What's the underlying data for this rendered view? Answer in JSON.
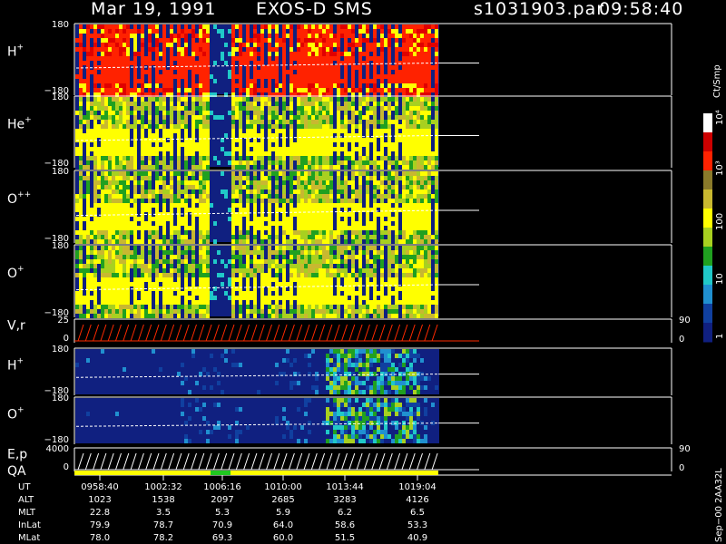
{
  "header": {
    "date": "Mar 19, 1991",
    "mission": "EXOS-D SMS",
    "file": "s1031903.par",
    "time": "09:58:40"
  },
  "colorbar": {
    "unit": "Ct/Smp",
    "ticks": [
      "10⁴",
      "10³",
      "100",
      "10",
      "1"
    ],
    "colors": [
      "#ffffff",
      "#cc0000",
      "#ff2200",
      "#8a7a2a",
      "#c8b830",
      "#ffff00",
      "#a8d020",
      "#20a020",
      "#20c8c8",
      "#2090d0",
      "#1040a0",
      "#102080"
    ]
  },
  "panels": [
    {
      "id": "hplus-top",
      "label": "H",
      "sup": "+",
      "ymax": "180",
      "ymin": "−180",
      "style": "spectro-red"
    },
    {
      "id": "heplus",
      "label": "He",
      "sup": "+",
      "ymax": "180",
      "ymin": "−180",
      "style": "spectro-yellow"
    },
    {
      "id": "oplusplus",
      "label": "O",
      "sup": "++",
      "ymax": "180",
      "ymin": "−180",
      "style": "spectro-yellow"
    },
    {
      "id": "oplus-top",
      "label": "O",
      "sup": "+",
      "ymax": "180",
      "ymin": "−180",
      "style": "spectro-yellow"
    },
    {
      "id": "vr",
      "label": "V,r",
      "sup": "",
      "ymax": "25",
      "ymin": "0",
      "right_top": "90",
      "right_bot": "0",
      "style": "line"
    },
    {
      "id": "hplus-low",
      "label": "H",
      "sup": "+",
      "ymax": "180",
      "ymin": "−180",
      "style": "spectro-blue"
    },
    {
      "id": "oplus-low",
      "label": "O",
      "sup": "+",
      "ymax": "180",
      "ymin": "−180",
      "style": "spectro-blue"
    },
    {
      "id": "ep",
      "label": "E,p",
      "sup": "",
      "ymax": "4000",
      "ymin": "0",
      "right_top": "90",
      "right_bot": "0",
      "style": "line"
    }
  ],
  "qa_label": "QA",
  "footer": {
    "rows": [
      {
        "name": "UT",
        "values": [
          "0958:40",
          "1002:32",
          "1006:16",
          "1010:00",
          "1013:44",
          "1019:04"
        ]
      },
      {
        "name": "ALT",
        "values": [
          "1023",
          "1538",
          "2097",
          "2685",
          "3283",
          "4126"
        ]
      },
      {
        "name": "MLT",
        "values": [
          "22.8",
          "3.5",
          "5.3",
          "5.9",
          "6.2",
          "6.5"
        ]
      },
      {
        "name": "InLat",
        "values": [
          "79.9",
          "78.7",
          "70.9",
          "64.0",
          "58.6",
          "53.3"
        ]
      },
      {
        "name": "MLat",
        "values": [
          "78.0",
          "78.2",
          "69.3",
          "60.0",
          "51.5",
          "40.9"
        ]
      }
    ]
  },
  "side_label": "Sep−00  2AA32L",
  "chart_data": {
    "type": "heatmap",
    "title": "Mar 19, 1991   EXOS-D SMS",
    "x": [
      "0958:40",
      "1002:32",
      "1006:16",
      "1010:00",
      "1013:44",
      "1019:04"
    ],
    "panels": [
      {
        "name": "H+",
        "ylim": [
          -180,
          180
        ]
      },
      {
        "name": "He+",
        "ylim": [
          -180,
          180
        ]
      },
      {
        "name": "O++",
        "ylim": [
          -180,
          180
        ]
      },
      {
        "name": "O+",
        "ylim": [
          -180,
          180
        ]
      },
      {
        "name": "V,r",
        "ylim": [
          0,
          25
        ]
      },
      {
        "name": "H+",
        "ylim": [
          -180,
          180
        ]
      },
      {
        "name": "O+",
        "ylim": [
          -180,
          180
        ]
      },
      {
        "name": "E,p",
        "ylim": [
          0,
          4000
        ]
      }
    ],
    "colorbar": {
      "unit": "Ct/Smp",
      "scale": "log",
      "range": [
        1,
        10000
      ]
    }
  }
}
